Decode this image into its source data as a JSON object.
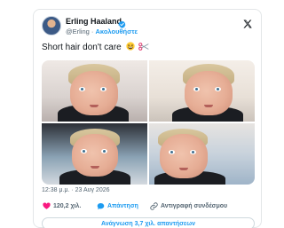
{
  "tweet": {
    "author_name": "Erling Haaland",
    "handle": "@Erling",
    "separator": "·",
    "follow_label": "Ακολουθήστε",
    "text": "Short hair don't care",
    "timestamp": "12:38 μ.μ. · 23 Αυγ 2026",
    "likes": "120,2 χιλ.",
    "reply_label": "Απάντηση",
    "copy_link_label": "Αντιγραφή συνδέσμου",
    "read_replies_label": "Ανάγνωση 3,7 χιλ. απαντήσεων"
  },
  "icons": {
    "verified": "verified-badge-icon",
    "brand": "x-logo-icon",
    "emoji_1": "grinning-squint-face-icon",
    "emoji_2": "scissors-icon",
    "like": "heart-icon",
    "reply": "speech-bubble-icon",
    "copy": "link-icon"
  },
  "colors": {
    "accent": "#1d9bf0",
    "like": "#f91880",
    "text": "#0f1419",
    "muted": "#536471",
    "border": "#cfd9de"
  }
}
